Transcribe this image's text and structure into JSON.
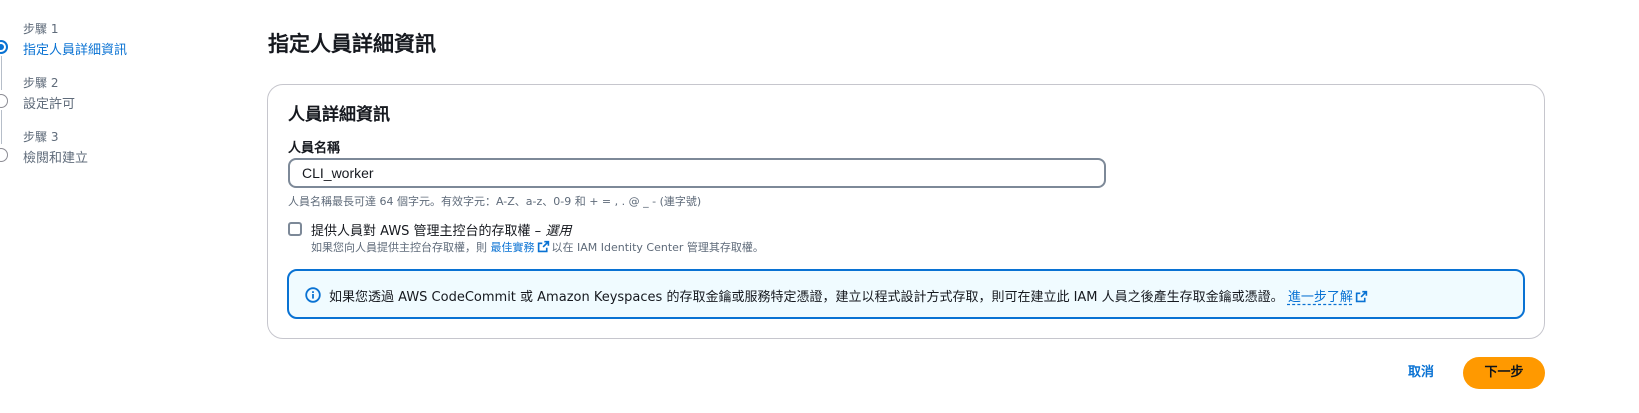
{
  "steps": [
    {
      "number": "步驟 1",
      "title": "指定人員詳細資訊",
      "state": "active"
    },
    {
      "number": "步驟 2",
      "title": "設定許可",
      "state": "pending"
    },
    {
      "number": "步驟 3",
      "title": "檢閱和建立",
      "state": "pending"
    }
  ],
  "page": {
    "title": "指定人員詳細資訊"
  },
  "details": {
    "title": "人員詳細資訊",
    "name_label": "人員名稱",
    "name_value": "CLI_worker",
    "name_hint": "人員名稱最長可達 64 個字元。有效字元：A-Z、a-z、0-9 和 + = , . @ _ - (連字號)",
    "console_access": {
      "label": "提供人員對 AWS 管理主控台的存取權 –",
      "optional": "選用",
      "checked": false,
      "desc_prefix": "如果您向人員提供主控台存取權，則",
      "desc_link": "最佳實務",
      "desc_suffix": "以在 IAM Identity Center 管理其存取權。"
    },
    "info_alert": {
      "text": "如果您透過 AWS CodeCommit 或 Amazon Keyspaces 的存取金鑰或服務特定憑證，建立以程式設計方式存取，則可在建立此 IAM 人員之後產生存取金鑰或憑證。",
      "link": "進一步了解"
    }
  },
  "actions": {
    "cancel": "取消",
    "next": "下一步"
  },
  "colors": {
    "accent": "#0972d3",
    "primary_button": "#ff9900",
    "alert_bg": "#f0fbff",
    "text_secondary": "#5f6b7a"
  },
  "icons": {
    "external_link": "external-link-icon",
    "info": "info-icon"
  }
}
